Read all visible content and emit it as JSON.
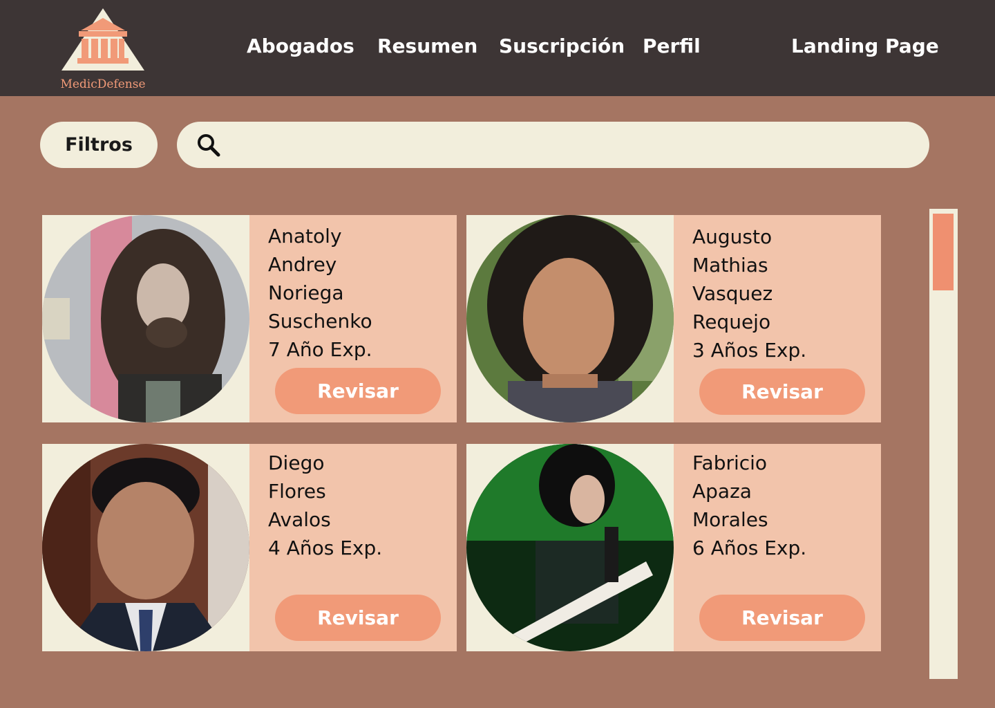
{
  "app": {
    "logo_text": "MedicDefense",
    "accent_color": "#f19a78"
  },
  "nav": {
    "items": [
      {
        "label": "Abogados"
      },
      {
        "label": "Resumen"
      },
      {
        "label": "Suscripción"
      },
      {
        "label": "Perfil"
      },
      {
        "label": "Landing Page"
      }
    ]
  },
  "search": {
    "filters_label": "Filtros",
    "value": "",
    "placeholder": ""
  },
  "cards": [
    {
      "lines": [
        "Anatoly",
        "Andrey",
        "Noriega",
        "Suschenko",
        "7 Año Exp."
      ],
      "button": "Revisar"
    },
    {
      "lines": [
        "Augusto",
        "Mathias",
        "Vasquez",
        "Requejo",
        "3 Años Exp."
      ],
      "button": "Revisar"
    },
    {
      "lines": [
        "Diego",
        "Flores",
        "Avalos",
        "4 Años Exp."
      ],
      "button": "Revisar"
    },
    {
      "lines": [
        "Fabricio",
        "Apaza",
        "Morales",
        "6 Años Exp."
      ],
      "button": "Revisar"
    }
  ]
}
